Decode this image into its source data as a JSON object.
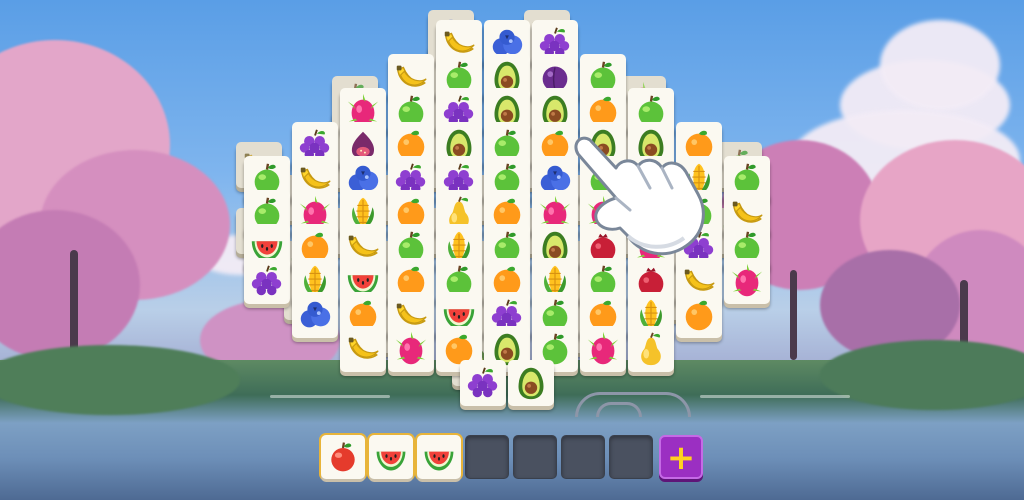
{
  "game": {
    "board": {
      "tile_rows": [
        [
          "banana",
          "blueberry",
          "grapes"
        ],
        [
          "banana",
          "apple",
          "avocado",
          "plum",
          "apple"
        ],
        [
          "dragonfruit",
          "apple",
          "grapes",
          "avocado",
          "avocado",
          "orange",
          "apple"
        ],
        [
          "grapes",
          "fig",
          "orange",
          "avocado",
          "apple",
          "orange",
          "avocado",
          "avocado",
          "orange"
        ],
        [
          "apple",
          "banana",
          "blueberry",
          "grapes",
          "grapes",
          "apple",
          "blueberry",
          "apple",
          "avocado",
          "corn",
          "apple"
        ],
        [
          "apple",
          "dragonfruit",
          "corn",
          "orange",
          "pear",
          "orange",
          "dragonfruit",
          "dragonfruit",
          "apple",
          "apple",
          "banana"
        ],
        [
          "watermelon",
          "orange",
          "banana",
          "apple",
          "corn",
          "apple",
          "avocado",
          "pomegranate",
          "dragonfruit",
          "grapes",
          "apple"
        ],
        [
          "grapes",
          "corn",
          "watermelon",
          "orange",
          "apple",
          "orange",
          "corn",
          "apple",
          "pomegranate",
          "banana",
          "dragonfruit"
        ],
        [
          "blueberry",
          "orange",
          "banana",
          "watermelon",
          "grapes",
          "apple",
          "orange",
          "corn",
          "orange"
        ],
        [
          "banana",
          "dragonfruit",
          "orange",
          "avocado",
          "apple",
          "dragonfruit",
          "pear"
        ],
        [
          "grapes",
          "avocado"
        ]
      ]
    },
    "hint_hand_icon": "pointing-hand-icon",
    "tray": {
      "capacity": 7,
      "slots": [
        "apple",
        "watermelon",
        "watermelon",
        "",
        "",
        "",
        ""
      ],
      "add_button_symbol": "+",
      "add_button_color": "#9b2fc2"
    }
  }
}
